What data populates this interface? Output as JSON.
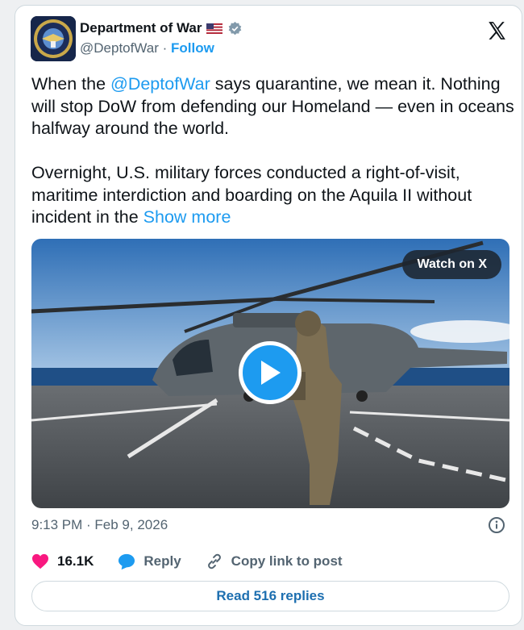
{
  "account": {
    "name": "Department of War",
    "handle": "@DeptofWar",
    "separator": "·",
    "follow_label": "Follow"
  },
  "post": {
    "line1_before": "When the ",
    "mention": "@DeptofWar",
    "line1_after": " says quarantine, we mean it. Nothing will stop DoW from defending our Homeland — even in oceans halfway around the world.",
    "para2": "Overnight, U.S. military forces conducted a right-of-visit, maritime interdiction and boarding on the Aquila II without incident in the ",
    "show_more": "Show more"
  },
  "media": {
    "watch_label": "Watch on X"
  },
  "timestamp": "9:13 PM · Feb 9, 2026",
  "actions": {
    "likes": "16.1K",
    "reply_label": "Reply",
    "copy_label": "Copy link to post"
  },
  "replies_button": "Read 516 replies",
  "colors": {
    "accent": "#1d9bf0",
    "like": "#f91880"
  }
}
